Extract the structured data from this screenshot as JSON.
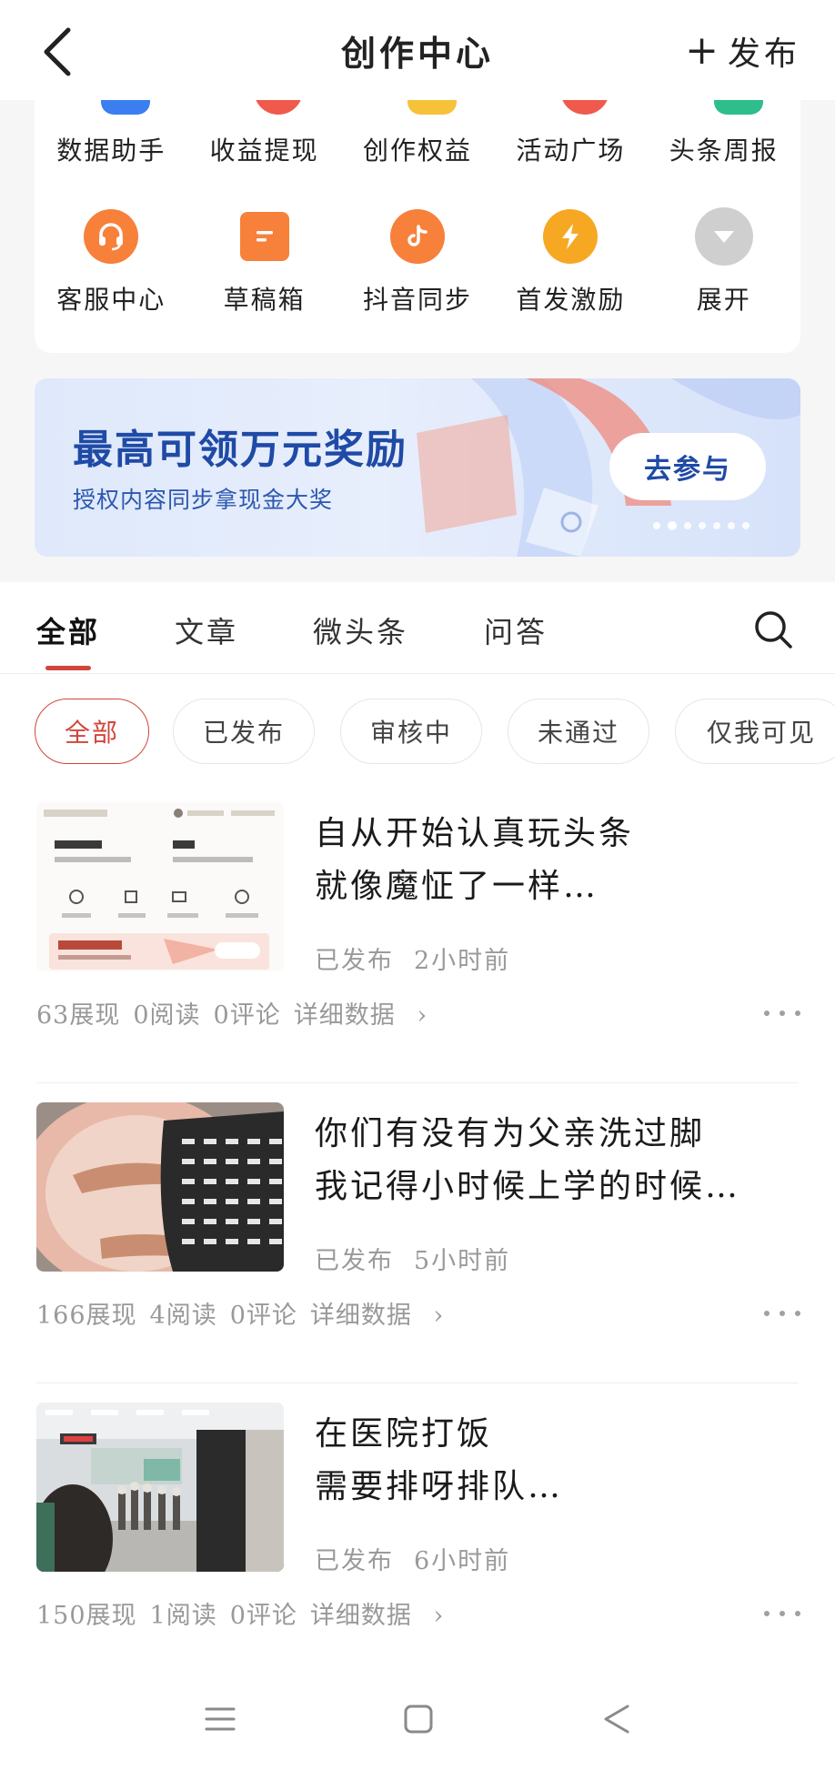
{
  "header": {
    "title": "创作中心",
    "publish_label": "发布",
    "back_icon": "chevron-left-icon",
    "publish_icon": "plus-icon"
  },
  "tools": {
    "row1": [
      {
        "label": "数据助手",
        "icon": "data-icon",
        "color": "#3b7ef0"
      },
      {
        "label": "收益提现",
        "icon": "money-icon",
        "color": "#ef5a4c"
      },
      {
        "label": "创作权益",
        "icon": "rights-icon",
        "color": "#f5c23a"
      },
      {
        "label": "活动广场",
        "icon": "activity-icon",
        "color": "#ef5a4c"
      },
      {
        "label": "头条周报",
        "icon": "report-icon",
        "color": "#2dbe8c"
      }
    ],
    "row2": [
      {
        "label": "客服中心",
        "icon": "headset-icon",
        "color": "#f7803a"
      },
      {
        "label": "草稿箱",
        "icon": "draft-icon",
        "color": "#f7803a"
      },
      {
        "label": "抖音同步",
        "icon": "douyin-icon",
        "color": "#f7803a"
      },
      {
        "label": "首发激励",
        "icon": "lightning-icon",
        "color": "#f7a823"
      },
      {
        "label": "展开",
        "icon": "chevron-down-icon",
        "color": "#cfcfcf"
      }
    ]
  },
  "banner": {
    "title": "最高可领万元奖励",
    "subtitle": "授权内容同步拿现金大奖",
    "cta": "去参与"
  },
  "tabs": [
    {
      "label": "全部"
    },
    {
      "label": "文章"
    },
    {
      "label": "微头条"
    },
    {
      "label": "问答"
    }
  ],
  "filters": [
    {
      "label": "全部"
    },
    {
      "label": "已发布"
    },
    {
      "label": "审核中"
    },
    {
      "label": "未通过"
    },
    {
      "label": "仅我可见"
    }
  ],
  "posts": [
    {
      "title_lines": [
        "自从开始认真玩头条",
        "就像魔怔了一样…"
      ],
      "status": "已发布",
      "time": "2小时前",
      "views": "63展现",
      "reads": "0阅读",
      "comments": "0评论",
      "detail": "详细数据",
      "thumb_kind": "screenshot"
    },
    {
      "title_lines": [
        "你们有没有为父亲洗过脚",
        "我记得小时候上学的时候…"
      ],
      "status": "已发布",
      "time": "5小时前",
      "views": "166展现",
      "reads": "4阅读",
      "comments": "0评论",
      "detail": "详细数据",
      "thumb_kind": "photo-basin"
    },
    {
      "title_lines": [
        "在医院打饭",
        "需要排呀排队…"
      ],
      "status": "已发布",
      "time": "6小时前",
      "views": "150展现",
      "reads": "1阅读",
      "comments": "0评论",
      "detail": "详细数据",
      "thumb_kind": "photo-hospital"
    }
  ],
  "colors": {
    "accent": "#d1453b",
    "banner_text": "#1f4aa6"
  }
}
